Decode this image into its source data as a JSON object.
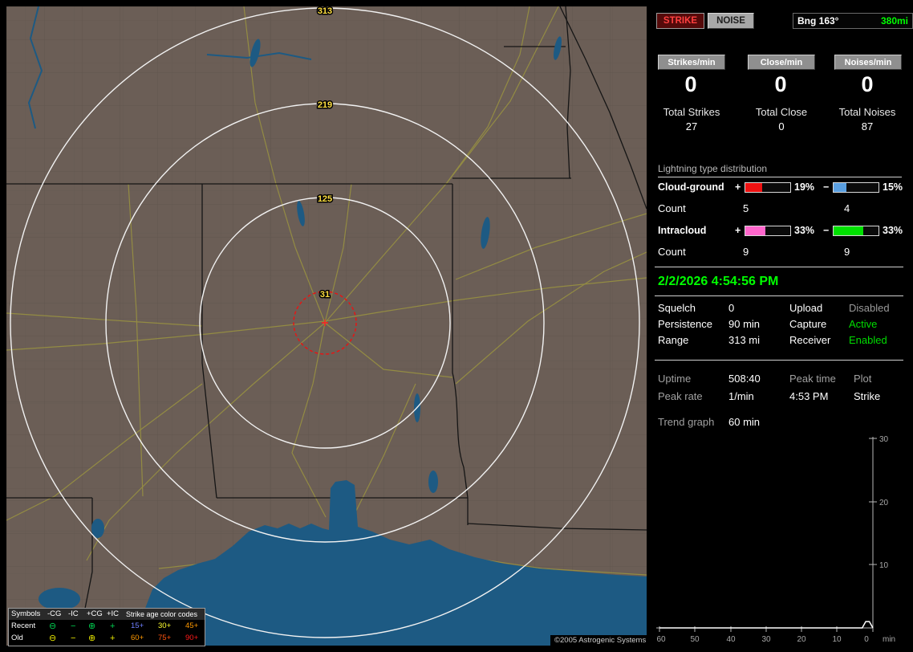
{
  "app": {
    "copyright": "©2005 Astrogenic Systems"
  },
  "map": {
    "ring_labels": {
      "r313": "313",
      "r219": "219",
      "r125": "125",
      "r31": "31"
    }
  },
  "legend": {
    "symbols_header": "Symbols",
    "age_header": "Strike age color codes",
    "columns": [
      "-CG",
      "-IC",
      "+CG",
      "+IC"
    ],
    "symbols": {
      "neg_cg": "⊖",
      "neg_ic": "−",
      "pos_cg": "⊕",
      "pos_ic": "+"
    },
    "rows": [
      {
        "label": "Recent",
        "symbol_color": "#00d050",
        "ages": [
          {
            "t": "15+",
            "color": "#6f7fff"
          },
          {
            "t": "30+",
            "color": "#ffff30"
          },
          {
            "t": "45+",
            "color": "#ff9900"
          }
        ]
      },
      {
        "label": "Old",
        "symbol_color": "#e6e600",
        "ages": [
          {
            "t": "60+",
            "color": "#ff9900"
          },
          {
            "t": "75+",
            "color": "#ff5510"
          },
          {
            "t": "90+",
            "color": "#ff1a1a"
          }
        ]
      }
    ]
  },
  "sidebar": {
    "strike_button": "STRIKE",
    "noise_button": "NOISE",
    "bearing": {
      "label": "Bng 163°",
      "value": "380mi",
      "value_color": "#00ff00"
    },
    "counters": [
      {
        "button": "Strikes/min",
        "rate": "0",
        "total_label": "Total Strikes",
        "total": "27"
      },
      {
        "button": "Close/min",
        "rate": "0",
        "total_label": "Total Close",
        "total": "0"
      },
      {
        "button": "Noises/min",
        "rate": "0",
        "total_label": "Total Noises",
        "total": "87"
      }
    ],
    "distribution": {
      "title": "Lightning type distribution",
      "count_label": "Count",
      "rows": [
        {
          "label": "Cloud-ground",
          "plus_sign": "+",
          "minus_sign": "−",
          "plus": {
            "pct": "19%",
            "fill_pct": 38,
            "color": "#ee1111",
            "count": "5"
          },
          "minus": {
            "pct": "15%",
            "fill_pct": 28,
            "color": "#5a9fe0",
            "count": "4"
          }
        },
        {
          "label": "Intracloud",
          "plus_sign": "+",
          "minus_sign": "−",
          "plus": {
            "pct": "33%",
            "fill_pct": 44,
            "color": "#ff66cc",
            "count": "9"
          },
          "minus": {
            "pct": "33%",
            "fill_pct": 66,
            "color": "#00e000",
            "count": "9"
          }
        }
      ]
    },
    "datetime": {
      "text": "2/2/2026 4:54:56 PM",
      "color": "#00ff00"
    },
    "settings": [
      {
        "k": "Squelch",
        "v": "0",
        "k2": "Upload",
        "v2": "Disabled",
        "v2_color": "#9a9a9a"
      },
      {
        "k": "Persistence",
        "v": "90 min",
        "k2": "Capture",
        "v2": "Active",
        "v2_color": "#00dd00"
      },
      {
        "k": "Range",
        "v": "313 mi",
        "k2": "Receiver",
        "v2": "Enabled",
        "v2_color": "#00dd00"
      }
    ],
    "stats": {
      "uptime_label": "Uptime",
      "uptime": "508:40",
      "peak_time_label": "Peak time",
      "plot_label": "Plot",
      "peak_rate_label": "Peak rate",
      "peak_rate": "1/min",
      "peak_time": "4:53 PM",
      "plot": "Strike",
      "trend_label": "Trend graph",
      "trend_window": "60 min"
    }
  },
  "chart_data": {
    "type": "line",
    "title": "Trend graph — strike rate, last 60 minutes",
    "xlabel": "min",
    "x_ticks": [
      60,
      50,
      40,
      30,
      20,
      10,
      0
    ],
    "y_ticks": [
      30,
      20,
      10
    ],
    "ylim": [
      0,
      30
    ],
    "xlim_minutes_ago": [
      60,
      0
    ],
    "grid": false,
    "legend_position": "none",
    "series": [
      {
        "name": "Strike",
        "x": [
          60,
          5,
          3,
          2,
          1,
          0
        ],
        "values": [
          0,
          0,
          0,
          1,
          1,
          0
        ]
      }
    ]
  }
}
